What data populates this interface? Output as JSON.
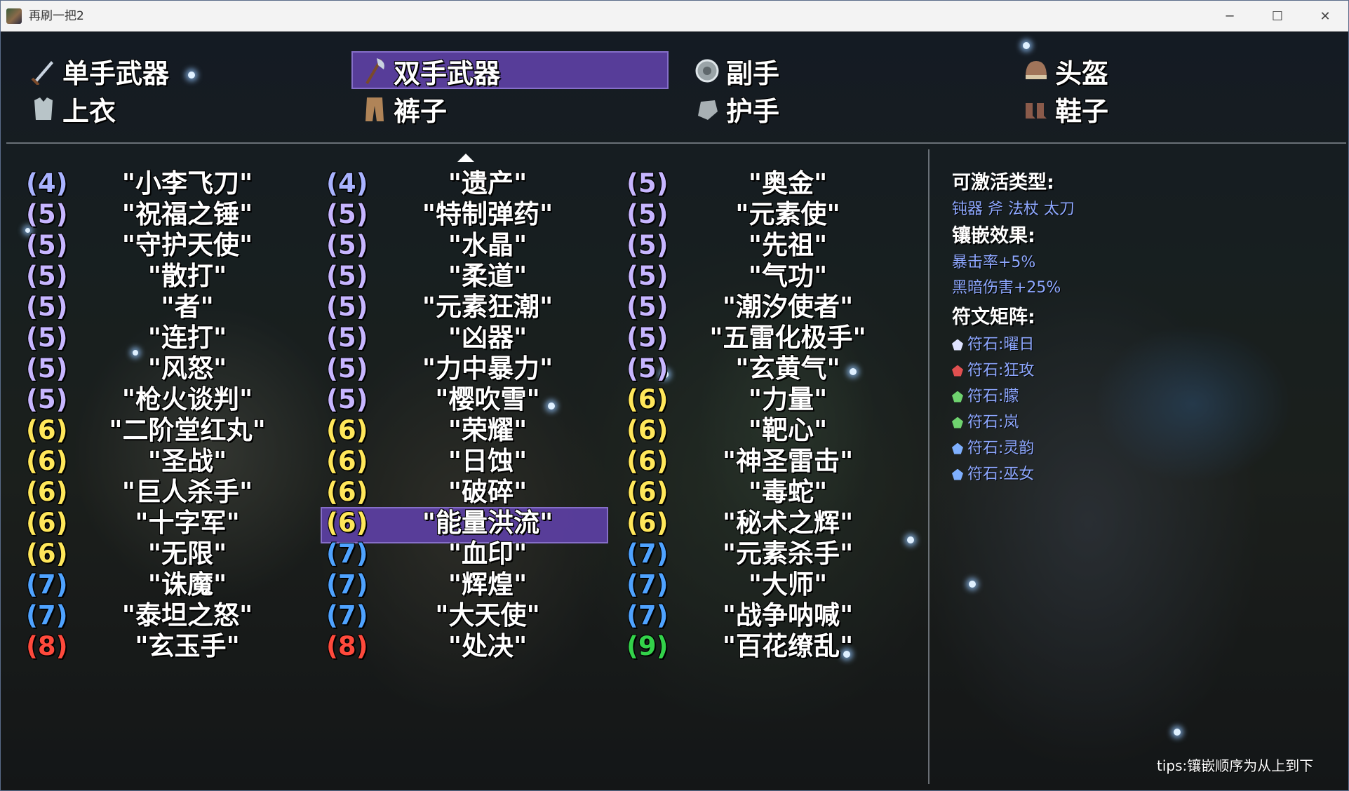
{
  "window": {
    "title": "再刷一把2",
    "minimize_label": "─",
    "maximize_label": "☐",
    "close_label": "✕"
  },
  "categories": [
    {
      "label": "单手武器",
      "icon": "sword-icon",
      "selected": false
    },
    {
      "label": "双手武器",
      "icon": "axe-icon",
      "selected": true
    },
    {
      "label": "副手",
      "icon": "orb-icon",
      "selected": false
    },
    {
      "label": "头盔",
      "icon": "helmet-icon",
      "selected": false
    },
    {
      "label": "上衣",
      "icon": "armor-icon",
      "selected": false
    },
    {
      "label": "裤子",
      "icon": "pants-icon",
      "selected": false
    },
    {
      "label": "护手",
      "icon": "gauntlet-icon",
      "selected": false
    },
    {
      "label": "鞋子",
      "icon": "boots-icon",
      "selected": false
    }
  ],
  "columns": [
    [
      {
        "level": "(4)",
        "name": "\"小李飞刀\""
      },
      {
        "level": "(5)",
        "name": "\"祝福之锤\""
      },
      {
        "level": "(5)",
        "name": "\"守护天使\""
      },
      {
        "level": "(5)",
        "name": "\"散打\""
      },
      {
        "level": "(5)",
        "name": "\"者\""
      },
      {
        "level": "(5)",
        "name": "\"连打\""
      },
      {
        "level": "(5)",
        "name": "\"风怒\""
      },
      {
        "level": "(5)",
        "name": "\"枪火谈判\""
      },
      {
        "level": "(6)",
        "name": "\"二阶堂红丸\""
      },
      {
        "level": "(6)",
        "name": "\"圣战\""
      },
      {
        "level": "(6)",
        "name": "\"巨人杀手\""
      },
      {
        "level": "(6)",
        "name": "\"十字军\""
      },
      {
        "level": "(6)",
        "name": "\"无限\""
      },
      {
        "level": "(7)",
        "name": "\"诛魔\""
      },
      {
        "level": "(7)",
        "name": "\"泰坦之怒\""
      },
      {
        "level": "(8)",
        "name": "\"玄玉手\""
      }
    ],
    [
      {
        "level": "(4)",
        "name": "\"遗产\""
      },
      {
        "level": "(5)",
        "name": "\"特制弹药\""
      },
      {
        "level": "(5)",
        "name": "\"水晶\""
      },
      {
        "level": "(5)",
        "name": "\"柔道\""
      },
      {
        "level": "(5)",
        "name": "\"元素狂潮\""
      },
      {
        "level": "(5)",
        "name": "\"凶器\""
      },
      {
        "level": "(5)",
        "name": "\"力中暴力\""
      },
      {
        "level": "(5)",
        "name": "\"樱吹雪\""
      },
      {
        "level": "(6)",
        "name": "\"荣耀\""
      },
      {
        "level": "(6)",
        "name": "\"日蚀\""
      },
      {
        "level": "(6)",
        "name": "\"破碎\""
      },
      {
        "level": "(6)",
        "name": "\"能量洪流\""
      },
      {
        "level": "(7)",
        "name": "\"血印\""
      },
      {
        "level": "(7)",
        "name": "\"辉煌\""
      },
      {
        "level": "(7)",
        "name": "\"大天使\""
      },
      {
        "level": "(8)",
        "name": "\"处决\""
      }
    ],
    [
      {
        "level": "(5)",
        "name": "\"奥金\""
      },
      {
        "level": "(5)",
        "name": "\"元素使\""
      },
      {
        "level": "(5)",
        "name": "\"先祖\""
      },
      {
        "level": "(5)",
        "name": "\"气功\""
      },
      {
        "level": "(5)",
        "name": "\"潮汐使者\""
      },
      {
        "level": "(5)",
        "name": "\"五雷化极手\""
      },
      {
        "level": "(5)",
        "name": "\"玄黄气\""
      },
      {
        "level": "(6)",
        "name": "\"力量\""
      },
      {
        "level": "(6)",
        "name": "\"靶心\""
      },
      {
        "level": "(6)",
        "name": "\"神圣雷击\""
      },
      {
        "level": "(6)",
        "name": "\"毒蛇\""
      },
      {
        "level": "(6)",
        "name": "\"秘术之辉\""
      },
      {
        "level": "(7)",
        "name": "\"元素杀手\""
      },
      {
        "level": "(7)",
        "name": "\"大师\""
      },
      {
        "level": "(7)",
        "name": "\"战争呐喊\""
      },
      {
        "level": "(9)",
        "name": "\"百花缭乱\""
      }
    ]
  ],
  "selected": {
    "column": 1,
    "row": 9
  },
  "info": {
    "activatable_header": "可激活类型:",
    "activatable_types": "钝器 斧 法杖 太刀",
    "effect_header": "镶嵌效果:",
    "effects": [
      "暴击率+5%",
      "黑暗伤害+25%"
    ],
    "matrix_header": "符文矩阵:",
    "runes": [
      {
        "label": "符石:曜日",
        "color": "#e0e4ff"
      },
      {
        "label": "符石:狂攻",
        "color": "#e05050"
      },
      {
        "label": "符石:朦",
        "color": "#6fd36f"
      },
      {
        "label": "符石:岚",
        "color": "#6fd36f"
      },
      {
        "label": "符石:灵韵",
        "color": "#7fb0ff"
      },
      {
        "label": "符石:巫女",
        "color": "#7fb0ff"
      }
    ]
  },
  "tips": "tips:镶嵌顺序为从上到下",
  "level_colors": {
    "4": "#a9b3ff",
    "5": "#c7b6ff",
    "6": "#ffe75a",
    "7": "#4fa3ff",
    "8": "#ff4a3c",
    "9": "#33d24a"
  }
}
